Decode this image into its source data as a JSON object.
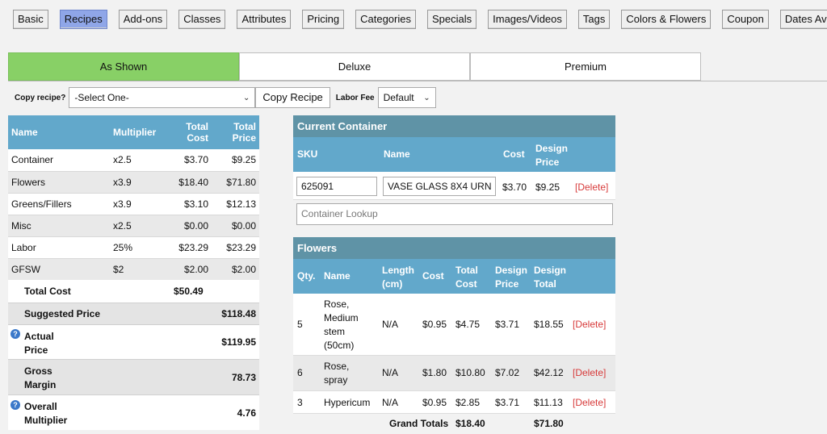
{
  "nav": [
    "Basic",
    "Recipes",
    "Add-ons",
    "Classes",
    "Attributes",
    "Pricing",
    "Categories",
    "Specials",
    "Images/Videos",
    "Tags",
    "Colors & Flowers",
    "Coupon",
    "Dates Available"
  ],
  "variants": [
    "As Shown",
    "Deluxe",
    "Premium"
  ],
  "copy": {
    "label": "Copy recipe?",
    "select_value": "-Select One-",
    "button": "Copy Recipe",
    "labor_label": "Labor Fee",
    "labor_value": "Default"
  },
  "summary": {
    "headers": [
      "Name",
      "Multiplier",
      "Total Cost",
      "Total Price"
    ],
    "rows": [
      [
        "Container",
        "x2.5",
        "$3.70",
        "$9.25"
      ],
      [
        "Flowers",
        "x3.9",
        "$18.40",
        "$71.80"
      ],
      [
        "Greens/Fillers",
        "x3.9",
        "$3.10",
        "$12.13"
      ],
      [
        "Misc",
        "x2.5",
        "$0.00",
        "$0.00"
      ],
      [
        "Labor",
        "25%",
        "$23.29",
        "$23.29"
      ],
      [
        "GFSW",
        "$2",
        "$2.00",
        "$2.00"
      ]
    ],
    "total_cost_label": "Total Cost",
    "total_cost_value": "$50.49",
    "suggested_label": "Suggested Price",
    "suggested_value": "$118.48",
    "actual_label": "Actual Price",
    "actual_value": "$119.95",
    "gross_label": "Gross Margin",
    "gross_value": "78.73",
    "overall_label": "Overall Multiplier",
    "overall_value": "4.76"
  },
  "container": {
    "title": "Current Container",
    "headers": [
      "SKU",
      "Name",
      "Cost",
      "Design Price"
    ],
    "sku": "625091",
    "name": "VASE GLASS 8X4 URN",
    "cost": "$3.70",
    "design_price": "$9.25",
    "delete": "[Delete]",
    "lookup_placeholder": "Container Lookup"
  },
  "flowers": {
    "title": "Flowers",
    "headers": [
      "Qty.",
      "Name",
      "Length (cm)",
      "Cost",
      "Total Cost",
      "Design Price",
      "Design Total"
    ],
    "rows": [
      {
        "qty": "5",
        "name": "Rose, Medium stem (50cm)",
        "length": "N/A",
        "cost": "$0.95",
        "total_cost": "$4.75",
        "design_price": "$3.71",
        "design_total": "$18.55",
        "delete": "[Delete]"
      },
      {
        "qty": "6",
        "name": "Rose, spray",
        "length": "N/A",
        "cost": "$1.80",
        "total_cost": "$10.80",
        "design_price": "$7.02",
        "design_total": "$42.12",
        "delete": "[Delete]"
      },
      {
        "qty": "3",
        "name": "Hypericum",
        "length": "N/A",
        "cost": "$0.95",
        "total_cost": "$2.85",
        "design_price": "$3.71",
        "design_total": "$11.13",
        "delete": "[Delete]"
      }
    ],
    "grand_label": "Grand Totals",
    "grand_cost": "$18.40",
    "grand_design": "$71.80"
  },
  "colors": {
    "active_tab": "#8fa6e8",
    "active_variant": "#88d066",
    "header_blue": "#62a8cb",
    "title_blue": "#5f93a6",
    "delete_red": "#d73a3a"
  }
}
